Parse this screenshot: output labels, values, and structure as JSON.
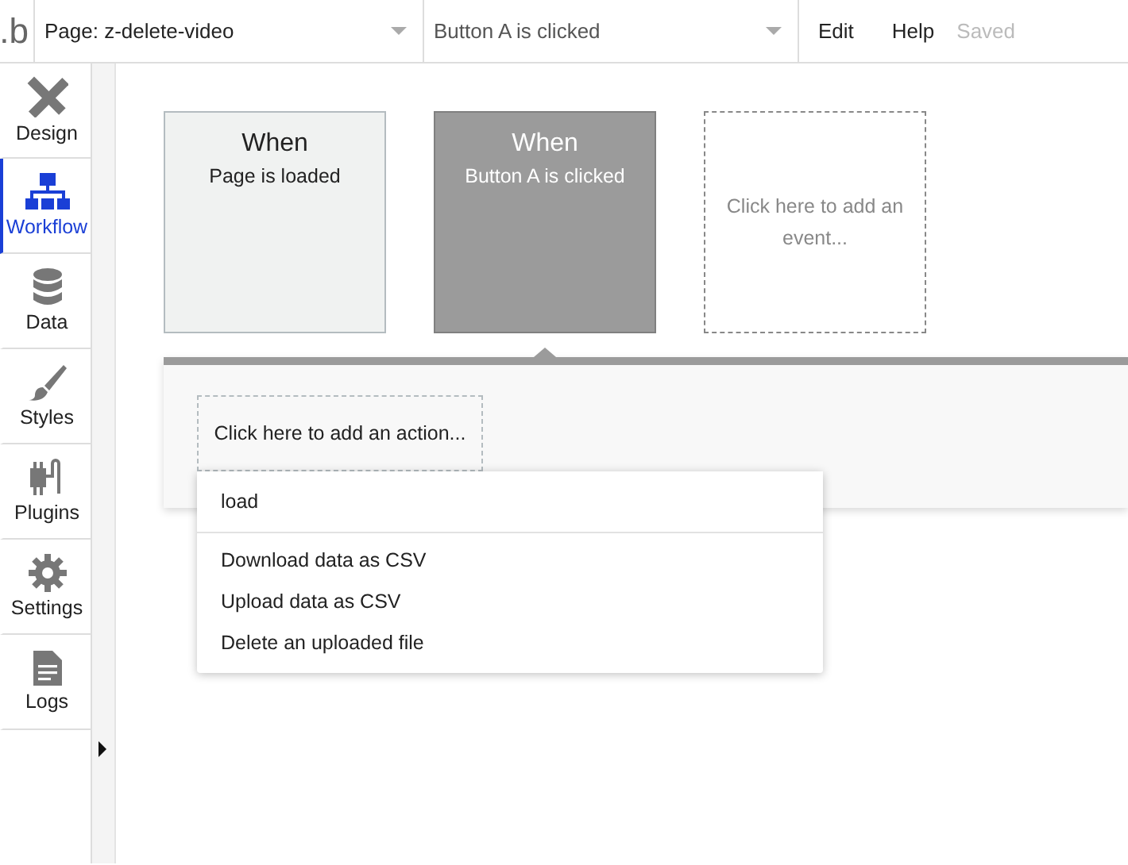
{
  "topbar": {
    "logo": ".b",
    "page_select": "Page: z-delete-video",
    "event_select": "Button A is clicked",
    "menu": [
      "Edit",
      "Help"
    ],
    "status": "Saved"
  },
  "sidebar": {
    "items": [
      {
        "label": "Design",
        "selected": false
      },
      {
        "label": "Workflow",
        "selected": true
      },
      {
        "label": "Data",
        "selected": false
      },
      {
        "label": "Styles",
        "selected": false
      },
      {
        "label": "Plugins",
        "selected": false
      },
      {
        "label": "Settings",
        "selected": false
      },
      {
        "label": "Logs",
        "selected": false
      }
    ]
  },
  "events": [
    {
      "kind": "event",
      "title": "When",
      "subtitle": "Page is loaded",
      "selected": false
    },
    {
      "kind": "event",
      "title": "When",
      "subtitle": "Button A is clicked",
      "selected": true
    },
    {
      "kind": "add",
      "label": "Click here to add an event..."
    }
  ],
  "actions": {
    "add_label": "Click here to add an action...",
    "search": {
      "value": "load"
    },
    "suggestions": [
      "Download data as CSV",
      "Upload data as CSV",
      "Delete an uploaded file"
    ]
  }
}
